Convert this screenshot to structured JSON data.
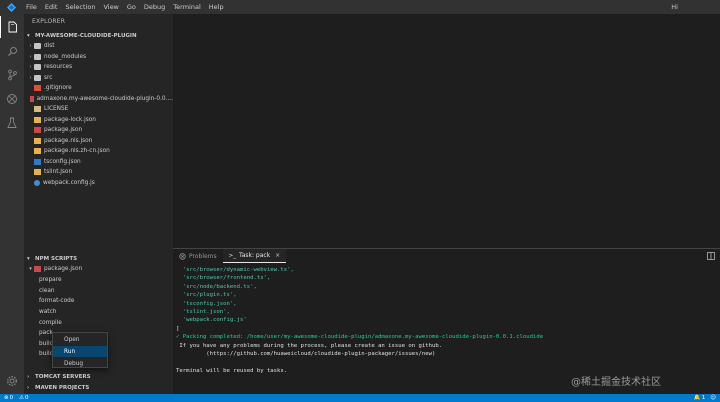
{
  "menu": {
    "items": [
      "File",
      "Edit",
      "Selection",
      "View",
      "Go",
      "Debug",
      "Terminal",
      "Help"
    ],
    "greeting": "Hi"
  },
  "activity_bar": {
    "icons": [
      "explorer-icon",
      "search-icon",
      "source-control-icon",
      "extensions-icon",
      "test-icon",
      "settings-icon"
    ]
  },
  "sidebar": {
    "title": "EXPLORER",
    "project": {
      "name": "MY-AWESOME-CLOUDIDE-PLUGIN",
      "items": [
        {
          "label": "dist",
          "type": "folder"
        },
        {
          "label": "node_modules",
          "type": "folder"
        },
        {
          "label": "resources",
          "type": "folder"
        },
        {
          "label": "src",
          "type": "folder"
        },
        {
          "label": ".gitignore",
          "type": "git"
        },
        {
          "label": "admaxone.my-awesome-cloudide-plugin-0.0....",
          "type": "package"
        },
        {
          "label": "LICENSE",
          "type": "license"
        },
        {
          "label": "package-lock.json",
          "type": "json"
        },
        {
          "label": "package.json",
          "type": "package"
        },
        {
          "label": "package.nls.json",
          "type": "json"
        },
        {
          "label": "package.nls.zh-cn.json",
          "type": "json"
        },
        {
          "label": "tsconfig.json",
          "type": "ts"
        },
        {
          "label": "tslint.json",
          "type": "json"
        },
        {
          "label": "webpack.config.js",
          "type": "js"
        }
      ]
    },
    "npm_scripts": {
      "title": "NPM SCRIPTS",
      "package": "package.json",
      "scripts": [
        "prepare",
        "clean",
        "format-code",
        "watch",
        "compile",
        "pack",
        "build",
        "build"
      ]
    },
    "tomcat_title": "TOMCAT SERVERS",
    "maven_title": "MAVEN PROJECTS"
  },
  "context_menu": {
    "items": [
      "Open",
      "Run",
      "Debug"
    ],
    "selected": "Run"
  },
  "panel": {
    "tabs": [
      {
        "label": "Problems"
      },
      {
        "label": "Task: pack"
      }
    ],
    "active_tab": "Task: pack",
    "terminal_lines": [
      "  'src/browser/dynamic-webview.ts',",
      "  'src/browser/frontend.ts',",
      "  'src/node/backend.ts',",
      "  'src/plugin.ts',",
      "  'tsconfig.json',",
      "  'tslint.json',",
      "  'webpack.config.js'",
      "]",
      "✓ Packing completed: /home/user/my-awesome-cloudide-plugin/admaxone.my-awesome-cloudide-plugin-0.0.1.cloudide",
      " If you have any problems during the process, please create an issue on github.",
      "         (https://github.com/huaweicloud/cloudide-plugin-packager/issues/new)",
      "",
      "Terminal will be reused by tasks."
    ]
  },
  "statusbar": {
    "left_count_errors": "0",
    "left_count_warnings": "0",
    "right_notifications": "1"
  },
  "watermark": "@稀土掘金技术社区"
}
